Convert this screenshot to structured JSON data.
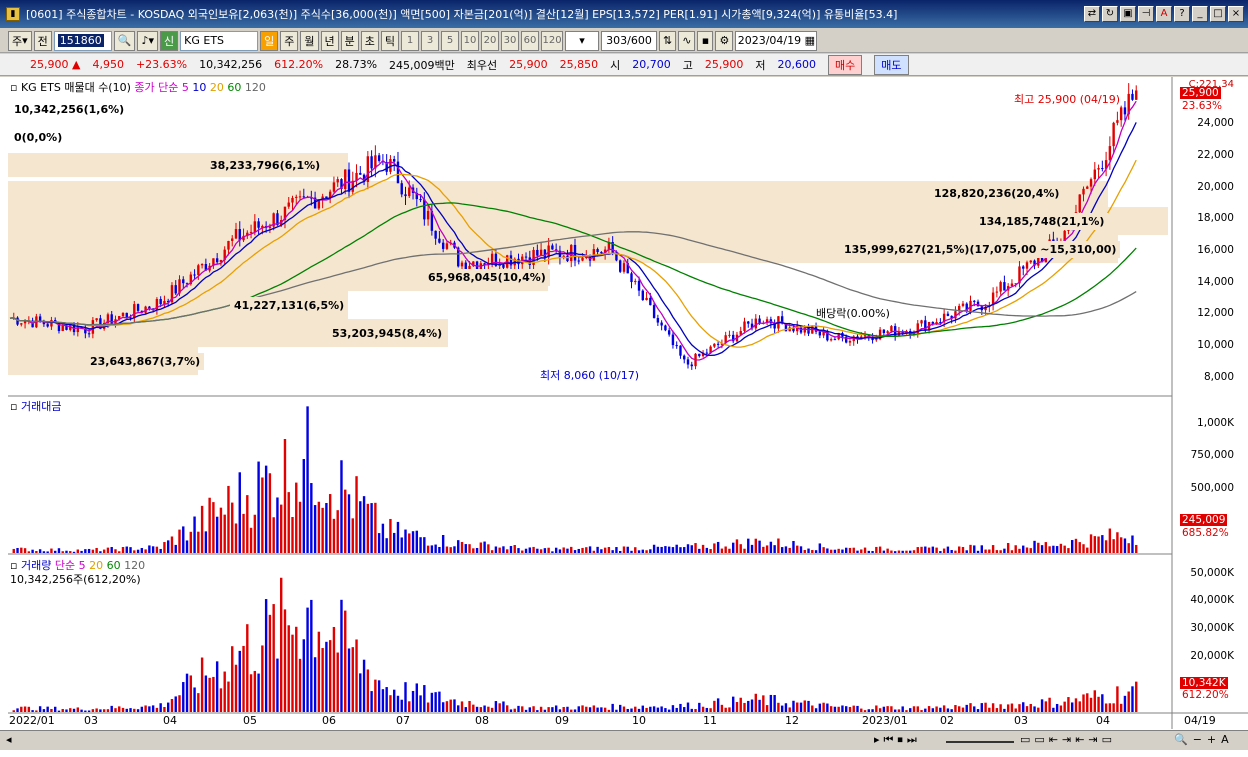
{
  "window": {
    "title": "[0601] 주식종합차트 - KOSDAQ 외국인보유[2,063(천)] 주식수[36,000(천)] 액면[500] 자본금[201(억)] 결산[12월] EPS[13,572] PER[1.91] 시가총액[9,324(억)] 유통비율[53.4]"
  },
  "toolbar": {
    "period": "주",
    "prev": "전",
    "code": "151860",
    "name": "KG ETS",
    "sig": "신",
    "intervals": [
      "일",
      "주",
      "월",
      "년",
      "분",
      "초",
      "틱"
    ],
    "nums": [
      "1",
      "3",
      "5",
      "10",
      "20",
      "30",
      "60",
      "120"
    ],
    "count": "303",
    "count_max": "/600",
    "date": "2023/04/19"
  },
  "quote": {
    "price": "25,900",
    "arrow": "▲",
    "change": "4,950",
    "pct": "+23.63%",
    "volume": "10,342,256",
    "vol_pct": "612.20%",
    "turnover": "28.73%",
    "amount": "245,009백만",
    "best_label": "최우선",
    "ask": "25,900",
    "bid": "25,850",
    "open_label": "시",
    "open": "20,700",
    "high_label": "고",
    "high": "25,900",
    "low_label": "저",
    "low": "20,600",
    "buy": "매수",
    "sell": "매도"
  },
  "price_panel": {
    "legend": "KG ETS 매물대 수(10)",
    "ma_label": "종가 단순",
    "ma": [
      "5",
      "10",
      "20",
      "60",
      "120"
    ],
    "vp_top": "10,342,256(1,6%)",
    "vp_zero": "0(0,0%)",
    "vp_labels": [
      "38,233,796(6,1%)",
      "128,820,236(20,4%)",
      "134,185,748(21,1%)",
      "135,999,627(21,5%)(17,075,00 ~15,310,00)",
      "65,968,045(10,4%)",
      "41,227,131(6,5%)",
      "53,203,945(8,4%)",
      "23,643,867(3,7%)"
    ],
    "high_note": "최고 25,900 (04/19)",
    "low_note": "최저 8,060 (10/17)",
    "div_note": "배당락(0.00%)",
    "axis": [
      "24,000",
      "22,000",
      "20,000",
      "18,000",
      "16,000",
      "14,000",
      "12,000",
      "10,000",
      "8,000"
    ],
    "axis_top": "C:221.34",
    "price_tag": "25,900",
    "pct_tag": "23.63%"
  },
  "amount_panel": {
    "legend": "거래대금",
    "axis": [
      "1,000K",
      "750,000",
      "500,000"
    ],
    "tag": "245,009",
    "pct": "685.82%"
  },
  "volume_panel": {
    "legend": "거래량",
    "ma_label": "단순",
    "ma": [
      "5",
      "20",
      "60",
      "120"
    ],
    "info": "10,342,256주(612,20%)",
    "axis": [
      "50,000K",
      "40,000K",
      "30,000K",
      "20,000K"
    ],
    "tag": "10,342K",
    "pct": "612.20%"
  },
  "xaxis": [
    "2022/01",
    "03",
    "04",
    "05",
    "06",
    "07",
    "08",
    "09",
    "10",
    "11",
    "12",
    "2023/01",
    "02",
    "03",
    "04",
    "04/19"
  ],
  "chart_data": {
    "type": "candlestick",
    "ylim": [
      7000,
      26500
    ],
    "x": [
      "2022/01",
      "2022/02",
      "2022/03",
      "2022/04",
      "2022/05",
      "2022/06",
      "2022/07",
      "2022/08",
      "2022/09",
      "2022/10",
      "2022/11",
      "2022/12",
      "2023/01",
      "2023/02",
      "2023/03",
      "2023/04"
    ],
    "close": [
      11500,
      10800,
      12500,
      16500,
      19000,
      21500,
      15000,
      15500,
      15800,
      8500,
      11500,
      10200,
      10800,
      12500,
      16500,
      25900
    ],
    "volume_k": [
      2000,
      1500,
      3000,
      28000,
      51000,
      12000,
      5000,
      2000,
      2500,
      3000,
      6000,
      2500,
      2000,
      3000,
      5000,
      10342
    ]
  }
}
